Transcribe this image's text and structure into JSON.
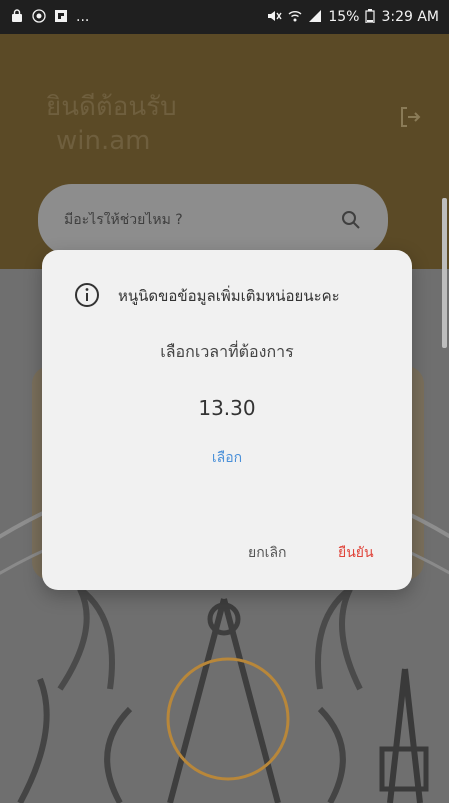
{
  "status_bar": {
    "notification_dots": "...",
    "battery": "15%",
    "time": "3:29 AM",
    "icons_left": [
      "shopping-bag-icon",
      "target-icon",
      "flipboard-icon"
    ],
    "icons_right": [
      "mute-icon",
      "wifi-icon",
      "signal-icon",
      "battery-icon"
    ]
  },
  "header": {
    "welcome_line1": "ยินดีต้อนรับ",
    "welcome_line2": "win.am",
    "logout_icon": "logout-icon"
  },
  "search": {
    "placeholder": "มีอะไรให้ช่วยไหม ?",
    "icon": "search-icon"
  },
  "dialog": {
    "message": "หนูนิดขอข้อมูลเพิ่มเติมหน่อยนะคะ",
    "subtitle": "เลือกเวลาที่ต้องการ",
    "time_value": "13.30",
    "select_label": "เลือก",
    "cancel_label": "ยกเลิก",
    "confirm_label": "ยืนยัน",
    "icon": "info-icon"
  },
  "colors": {
    "status_bar_bg": "#1f1f1f",
    "header_bg_dimmed": "#5b4a26",
    "dialog_bg": "#f1f1f1",
    "link_blue": "#4a90d9",
    "confirm_red": "#e0443a"
  }
}
